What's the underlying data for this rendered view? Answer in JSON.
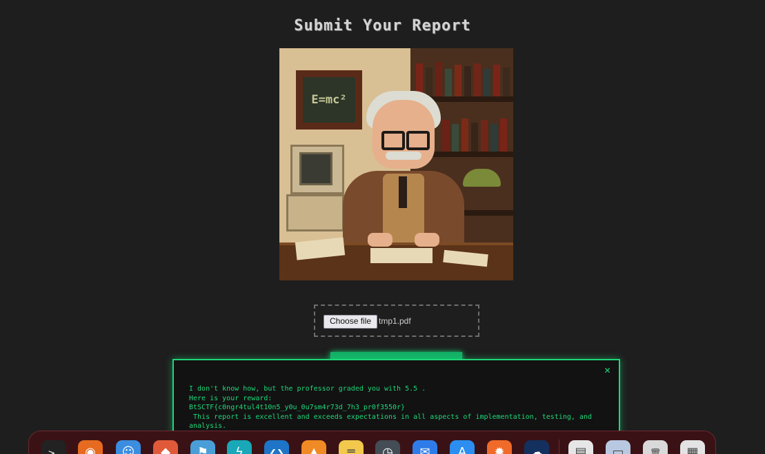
{
  "page": {
    "title": "Submit Your Report"
  },
  "illustration": {
    "blackboard_text": "E=mc²"
  },
  "upload": {
    "button_label": "Choose file",
    "file_name": "tmp1.pdf"
  },
  "modal": {
    "close_symbol": "✕",
    "line1": "I don't know how, but the professor graded you with 5.5 .",
    "line2": "Here is your reward:",
    "line3": "BtSCTF{c0ngr4tul4t10n5_y0u_0u7sm4r73d_7h3_pr0f3550r}",
    "line4": " This report is excellent and exceeds expectations in all aspects of implementation, testing, and analysis."
  },
  "dock": {
    "icons": [
      {
        "name": "terminal-icon",
        "glyph": ">_",
        "color": "#222222"
      },
      {
        "name": "firefox-icon",
        "glyph": "◉",
        "color": "#e66a1f"
      },
      {
        "name": "finder-icon",
        "glyph": "☺",
        "color": "#3b8de0"
      },
      {
        "name": "brave-icon",
        "glyph": "◆",
        "color": "#e05a3a"
      },
      {
        "name": "vpn-icon",
        "glyph": "⚑",
        "color": "#4a9ed8"
      },
      {
        "name": "flash-icon",
        "glyph": "ϟ",
        "color": "#19a8b8"
      },
      {
        "name": "vscode-icon",
        "glyph": "❮❯",
        "color": "#1e75c7"
      },
      {
        "name": "vlc-icon",
        "glyph": "▲",
        "color": "#f08a24"
      },
      {
        "name": "notes-icon",
        "glyph": "≡",
        "color": "#f2c94c"
      },
      {
        "name": "clock-icon",
        "glyph": "◷",
        "color": "#444c55"
      },
      {
        "name": "mail-icon",
        "glyph": "✉",
        "color": "#2f7ce8"
      },
      {
        "name": "appstore-icon",
        "glyph": "A",
        "color": "#2b8ef0"
      },
      {
        "name": "burp-icon",
        "glyph": "✹",
        "color": "#f06a2a"
      },
      {
        "name": "cloud-icon",
        "glyph": "☁",
        "color": "#14305e"
      },
      {
        "name": "document-icon",
        "glyph": "▤",
        "color": "#e6e6e6"
      },
      {
        "name": "folder-icon",
        "glyph": "▭",
        "color": "#b8c8e0"
      },
      {
        "name": "trash-icon",
        "glyph": "🗑",
        "color": "#d9d9d9"
      },
      {
        "name": "launchpad-icon",
        "glyph": "▦",
        "color": "#e3e3e3"
      }
    ]
  }
}
